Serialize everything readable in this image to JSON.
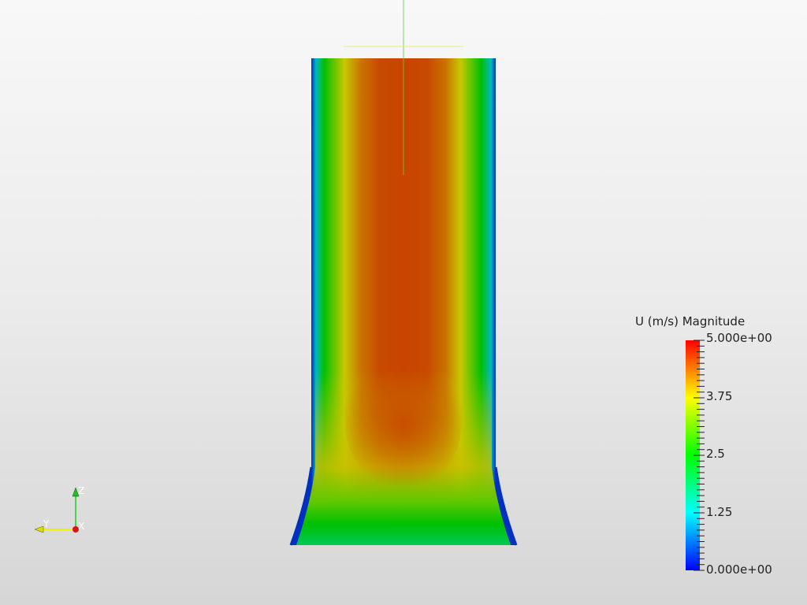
{
  "colorbar": {
    "title": "U (m/s) Magnitude",
    "min": 0,
    "max": 5,
    "labels": [
      "5.000e+00",
      "3.75",
      "2.5",
      "1.25",
      "0.000e+00"
    ],
    "colormap": [
      "#0000ff",
      "#00ffff",
      "#00ff00",
      "#ffff00",
      "#ff0000"
    ]
  },
  "orientation_axes": {
    "x": "X",
    "y": "Y",
    "z": "Z"
  }
}
